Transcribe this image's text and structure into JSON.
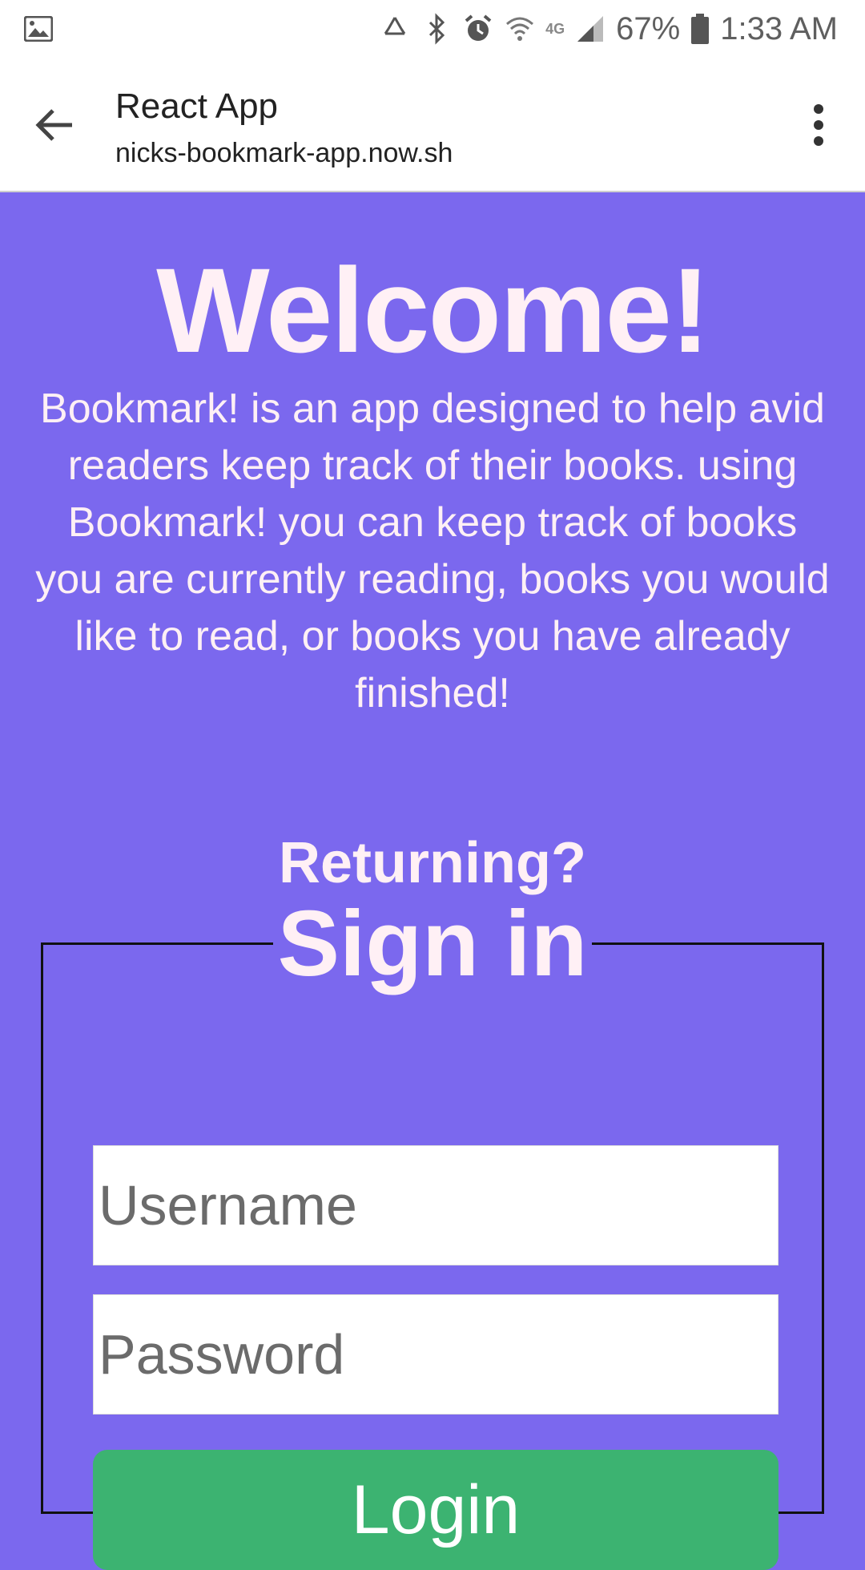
{
  "status_bar": {
    "battery_percent": "67%",
    "time": "1:33 AM",
    "network_label": "4G",
    "icons": [
      "image-icon",
      "recycle-icon",
      "bluetooth-icon",
      "alarm-icon",
      "wifi-icon",
      "signal-icon",
      "battery-icon"
    ]
  },
  "app_bar": {
    "title": "React App",
    "url": "nicks-bookmark-app.now.sh"
  },
  "main": {
    "heading": "Welcome!",
    "description": "Bookmark! is an app designed to help avid readers keep track of their books. using Bookmark! you can keep track of books you are currently reading, books you would like to read, or books you have already finished!",
    "returning_label": "Returning?",
    "signin_legend": "Sign in",
    "username_placeholder": "Username",
    "password_placeholder": "Password",
    "login_label": "Login"
  },
  "colors": {
    "background": "#7b68ee",
    "text": "#fff0f5",
    "login_button": "#3cb371"
  }
}
